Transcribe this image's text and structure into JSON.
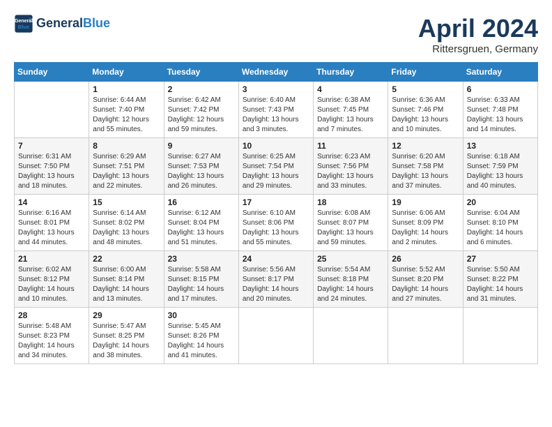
{
  "header": {
    "logo_line1": "General",
    "logo_line2": "Blue",
    "month_title": "April 2024",
    "subtitle": "Rittersgruen, Germany"
  },
  "days_of_week": [
    "Sunday",
    "Monday",
    "Tuesday",
    "Wednesday",
    "Thursday",
    "Friday",
    "Saturday"
  ],
  "weeks": [
    [
      {
        "num": "",
        "info": ""
      },
      {
        "num": "1",
        "info": "Sunrise: 6:44 AM\nSunset: 7:40 PM\nDaylight: 12 hours\nand 55 minutes."
      },
      {
        "num": "2",
        "info": "Sunrise: 6:42 AM\nSunset: 7:42 PM\nDaylight: 12 hours\nand 59 minutes."
      },
      {
        "num": "3",
        "info": "Sunrise: 6:40 AM\nSunset: 7:43 PM\nDaylight: 13 hours\nand 3 minutes."
      },
      {
        "num": "4",
        "info": "Sunrise: 6:38 AM\nSunset: 7:45 PM\nDaylight: 13 hours\nand 7 minutes."
      },
      {
        "num": "5",
        "info": "Sunrise: 6:36 AM\nSunset: 7:46 PM\nDaylight: 13 hours\nand 10 minutes."
      },
      {
        "num": "6",
        "info": "Sunrise: 6:33 AM\nSunset: 7:48 PM\nDaylight: 13 hours\nand 14 minutes."
      }
    ],
    [
      {
        "num": "7",
        "info": "Sunrise: 6:31 AM\nSunset: 7:50 PM\nDaylight: 13 hours\nand 18 minutes."
      },
      {
        "num": "8",
        "info": "Sunrise: 6:29 AM\nSunset: 7:51 PM\nDaylight: 13 hours\nand 22 minutes."
      },
      {
        "num": "9",
        "info": "Sunrise: 6:27 AM\nSunset: 7:53 PM\nDaylight: 13 hours\nand 26 minutes."
      },
      {
        "num": "10",
        "info": "Sunrise: 6:25 AM\nSunset: 7:54 PM\nDaylight: 13 hours\nand 29 minutes."
      },
      {
        "num": "11",
        "info": "Sunrise: 6:23 AM\nSunset: 7:56 PM\nDaylight: 13 hours\nand 33 minutes."
      },
      {
        "num": "12",
        "info": "Sunrise: 6:20 AM\nSunset: 7:58 PM\nDaylight: 13 hours\nand 37 minutes."
      },
      {
        "num": "13",
        "info": "Sunrise: 6:18 AM\nSunset: 7:59 PM\nDaylight: 13 hours\nand 40 minutes."
      }
    ],
    [
      {
        "num": "14",
        "info": "Sunrise: 6:16 AM\nSunset: 8:01 PM\nDaylight: 13 hours\nand 44 minutes."
      },
      {
        "num": "15",
        "info": "Sunrise: 6:14 AM\nSunset: 8:02 PM\nDaylight: 13 hours\nand 48 minutes."
      },
      {
        "num": "16",
        "info": "Sunrise: 6:12 AM\nSunset: 8:04 PM\nDaylight: 13 hours\nand 51 minutes."
      },
      {
        "num": "17",
        "info": "Sunrise: 6:10 AM\nSunset: 8:06 PM\nDaylight: 13 hours\nand 55 minutes."
      },
      {
        "num": "18",
        "info": "Sunrise: 6:08 AM\nSunset: 8:07 PM\nDaylight: 13 hours\nand 59 minutes."
      },
      {
        "num": "19",
        "info": "Sunrise: 6:06 AM\nSunset: 8:09 PM\nDaylight: 14 hours\nand 2 minutes."
      },
      {
        "num": "20",
        "info": "Sunrise: 6:04 AM\nSunset: 8:10 PM\nDaylight: 14 hours\nand 6 minutes."
      }
    ],
    [
      {
        "num": "21",
        "info": "Sunrise: 6:02 AM\nSunset: 8:12 PM\nDaylight: 14 hours\nand 10 minutes."
      },
      {
        "num": "22",
        "info": "Sunrise: 6:00 AM\nSunset: 8:14 PM\nDaylight: 14 hours\nand 13 minutes."
      },
      {
        "num": "23",
        "info": "Sunrise: 5:58 AM\nSunset: 8:15 PM\nDaylight: 14 hours\nand 17 minutes."
      },
      {
        "num": "24",
        "info": "Sunrise: 5:56 AM\nSunset: 8:17 PM\nDaylight: 14 hours\nand 20 minutes."
      },
      {
        "num": "25",
        "info": "Sunrise: 5:54 AM\nSunset: 8:18 PM\nDaylight: 14 hours\nand 24 minutes."
      },
      {
        "num": "26",
        "info": "Sunrise: 5:52 AM\nSunset: 8:20 PM\nDaylight: 14 hours\nand 27 minutes."
      },
      {
        "num": "27",
        "info": "Sunrise: 5:50 AM\nSunset: 8:22 PM\nDaylight: 14 hours\nand 31 minutes."
      }
    ],
    [
      {
        "num": "28",
        "info": "Sunrise: 5:48 AM\nSunset: 8:23 PM\nDaylight: 14 hours\nand 34 minutes."
      },
      {
        "num": "29",
        "info": "Sunrise: 5:47 AM\nSunset: 8:25 PM\nDaylight: 14 hours\nand 38 minutes."
      },
      {
        "num": "30",
        "info": "Sunrise: 5:45 AM\nSunset: 8:26 PM\nDaylight: 14 hours\nand 41 minutes."
      },
      {
        "num": "",
        "info": ""
      },
      {
        "num": "",
        "info": ""
      },
      {
        "num": "",
        "info": ""
      },
      {
        "num": "",
        "info": ""
      }
    ]
  ]
}
